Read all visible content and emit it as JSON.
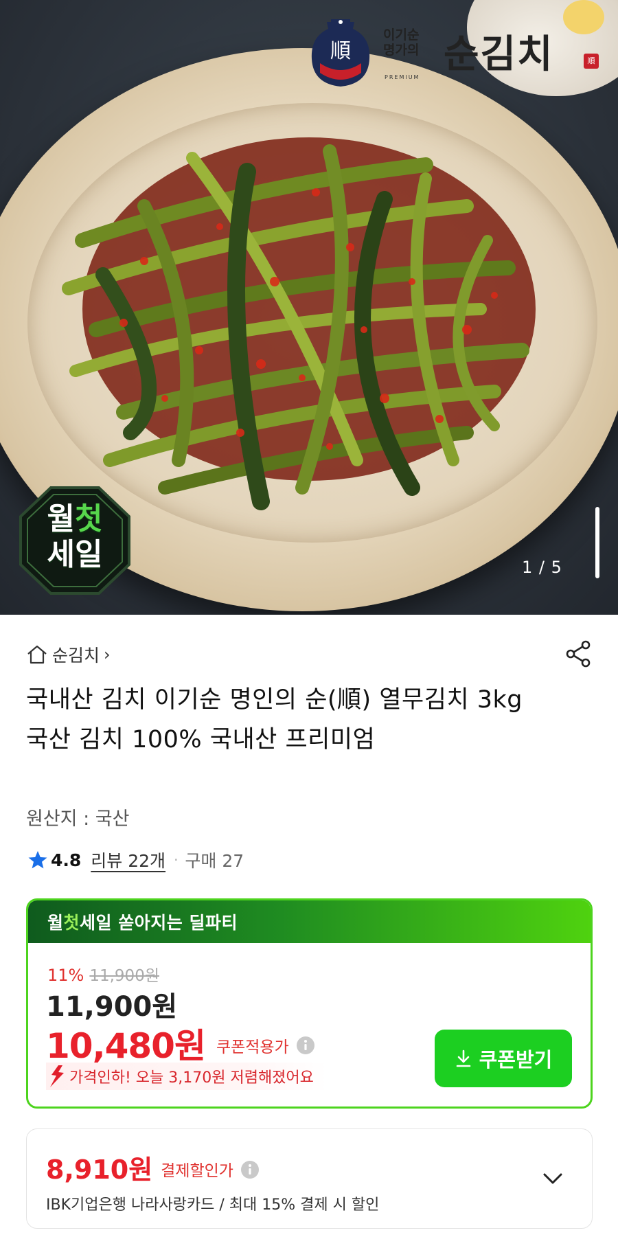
{
  "hero": {
    "logo_sub": "이기순\n명가의",
    "logo_premium": "PREMIUM",
    "logo_title": "순김치",
    "logo_seal": "順",
    "logo_jar_char": "順",
    "badge_line1_a": "월",
    "badge_line1_b": "첫",
    "badge_line2": "세일",
    "image_counter": "1 / 5"
  },
  "store": {
    "name": "순김치",
    "chevron": "›"
  },
  "product": {
    "title": "국내산 김치 이기순 명인의 순(順) 열무김치 3kg 국산 김치 100% 국내산 프리미엄",
    "origin": "원산지 : 국산",
    "rating": "4.8",
    "review_link": "리뷰 22개",
    "dot": "·",
    "purchase": "구매 27"
  },
  "deal": {
    "header_a": "월",
    "header_b": "첫",
    "header_c": "세일 쏟아지는 딜파티",
    "discount_pct": "11%",
    "original_price": "11,900원",
    "base_price": "11,900원",
    "coupon_price": "10,480원",
    "coupon_label": "쿠폰적용가",
    "drop_text": "가격인하! 오늘 3,170원 저렴해졌어요",
    "coupon_button": "쿠폰받기"
  },
  "payment": {
    "price": "8,910원",
    "label": "결제할인가",
    "description": "IBK기업은행 나라사랑카드 / 최대 15% 결제 시 할인"
  },
  "colors": {
    "sale_red": "#e8212b",
    "deal_green": "#1ccf21",
    "deal_border": "#4dd41e"
  },
  "icons": [
    "home-icon",
    "share-icon",
    "star-icon",
    "info-icon",
    "price-drop-arrow-icon",
    "download-icon",
    "chevron-down-icon"
  ]
}
